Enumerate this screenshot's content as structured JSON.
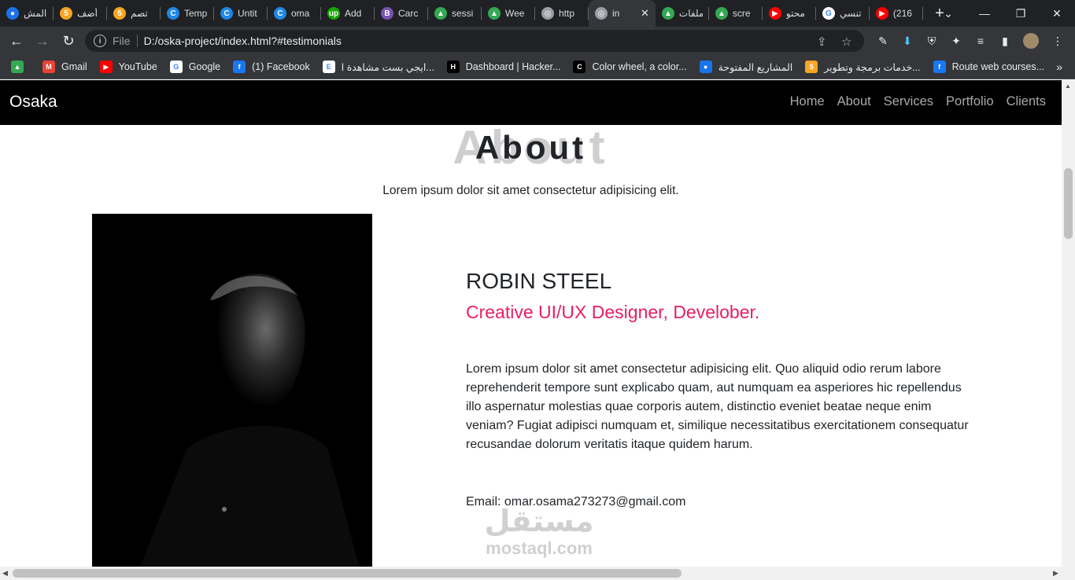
{
  "browser": {
    "tabs": [
      {
        "title": "المش",
        "color": "#1a73e8",
        "glyph": "●"
      },
      {
        "title": "أضف",
        "color": "#f5a623",
        "glyph": "5"
      },
      {
        "title": "تصم",
        "color": "#f5a623",
        "glyph": "5"
      },
      {
        "title": "Temp",
        "color": "#1e88e5",
        "glyph": "C"
      },
      {
        "title": "Untit",
        "color": "#1e88e5",
        "glyph": "C"
      },
      {
        "title": "oma",
        "color": "#1e88e5",
        "glyph": "C"
      },
      {
        "title": "Add",
        "color": "#14a800",
        "glyph": "up"
      },
      {
        "title": "Carc",
        "color": "#7952b3",
        "glyph": "B"
      },
      {
        "title": "sessi",
        "color": "#34a853",
        "glyph": "▲"
      },
      {
        "title": "Wee",
        "color": "#34a853",
        "glyph": "▲"
      },
      {
        "title": "http",
        "color": "#9aa0a6",
        "glyph": "◎"
      },
      {
        "title": "in",
        "color": "#9aa0a6",
        "glyph": "◎",
        "active": true
      },
      {
        "title": "ملفات",
        "color": "#34a853",
        "glyph": "▲"
      },
      {
        "title": "scre",
        "color": "#34a853",
        "glyph": "▲"
      },
      {
        "title": "محتو",
        "color": "#ff0000",
        "glyph": "▶"
      },
      {
        "title": "تنسي",
        "color": "#ffffff",
        "glyph": "G"
      },
      {
        "title": "(216",
        "color": "#ff0000",
        "glyph": "▶"
      }
    ],
    "omnibox": {
      "scheme_label": "File",
      "url": "D:/oska-project/index.html?#testimonials"
    },
    "bookmarks": [
      {
        "label": "",
        "color": "#34a853",
        "glyph": "▲"
      },
      {
        "label": "Gmail",
        "color": "#ea4335",
        "glyph": "M"
      },
      {
        "label": "YouTube",
        "color": "#ff0000",
        "glyph": "▶"
      },
      {
        "label": "Google",
        "color": "#ffffff",
        "glyph": "G"
      },
      {
        "label": "(1) Facebook",
        "color": "#1877f2",
        "glyph": "f"
      },
      {
        "label": "ايجي بست مشاهدة ا...",
        "color": "#ffffff",
        "glyph": "E"
      },
      {
        "label": "Dashboard | Hacker...",
        "color": "#000000",
        "glyph": "H"
      },
      {
        "label": "Color wheel, a color...",
        "color": "#000000",
        "glyph": "C"
      },
      {
        "label": "المشاريع المفتوحة",
        "color": "#1a73e8",
        "glyph": "●"
      },
      {
        "label": "خدمات برمجة وتطوير...",
        "color": "#f5a623",
        "glyph": "5"
      },
      {
        "label": "Route web courses...",
        "color": "#1877f2",
        "glyph": "f"
      }
    ]
  },
  "site": {
    "brand": "Osaka",
    "nav": [
      "Home",
      "About",
      "Services",
      "Portfolio",
      "Clients"
    ]
  },
  "about": {
    "title_shadow": "About",
    "title": "About",
    "subtitle": "Lorem ipsum dolor sit amet consectetur adipisicing elit.",
    "name": "ROBIN STEEL",
    "role": "Creative UI/UX Designer, Develober.",
    "description": "Lorem ipsum dolor sit amet consectetur adipisicing elit. Quo aliquid odio rerum labore reprehenderit tempore sunt explicabo quam, aut numquam ea asperiores hic repellendus illo aspernatur molestias quae corporis autem, distinctio eveniet beatae neque enim veniam? Fugiat adipisci numquam et, similique necessitatibus exercitationem consequatur recusandae dolorum veritatis itaque quidem harum.",
    "email": "Email: omar.osama273273@gmail.com"
  },
  "watermark": {
    "arabic": "مستقل",
    "latin": "mostaql.com"
  }
}
